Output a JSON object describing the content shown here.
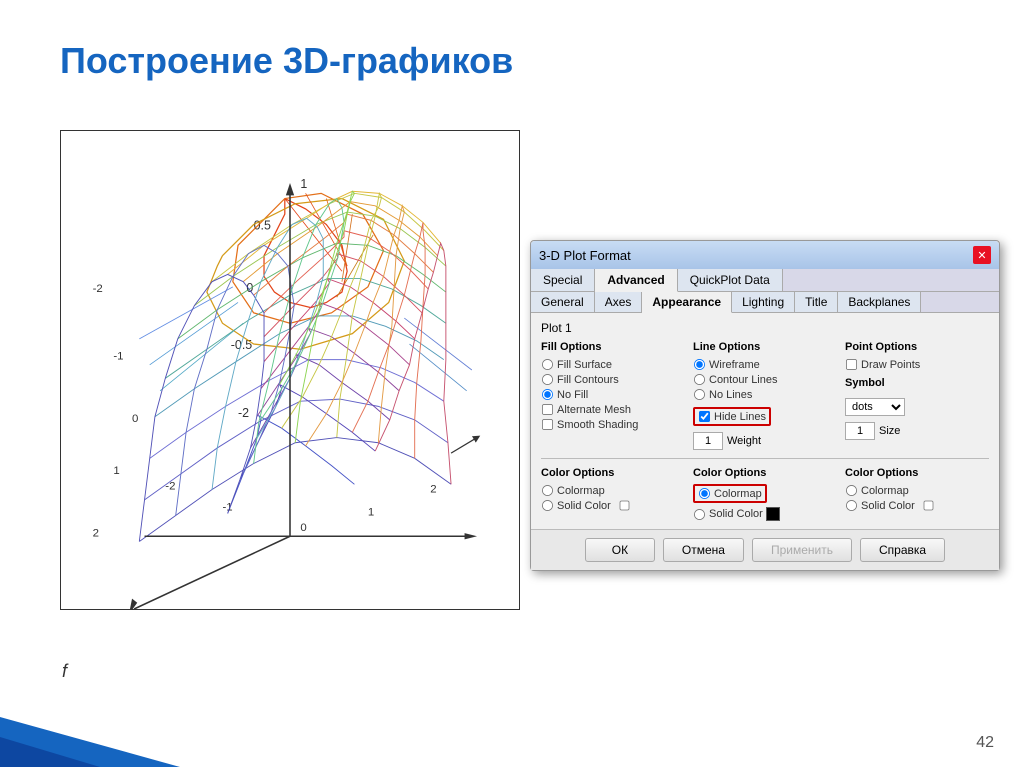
{
  "slide": {
    "title": "Построение 3D-графиков",
    "bottom_label": "f",
    "page_number": "42"
  },
  "dialog": {
    "title": "3-D Plot Format",
    "tabs_row1": [
      "Special",
      "Advanced",
      "QuickPlot Data"
    ],
    "tabs_row2": [
      "General",
      "Axes",
      "Appearance",
      "Lighting",
      "Title",
      "Backplanes"
    ],
    "active_tab_row1": "Advanced",
    "active_tab_row2": "Appearance",
    "plot_label": "Plot 1",
    "fill_options": {
      "header": "Fill Options",
      "items": [
        "Fill Surface",
        "Fill Contours",
        "No Fill",
        "Alternate Mesh",
        "Smooth Shading"
      ]
    },
    "line_options": {
      "header": "Line Options",
      "items": [
        "Wireframe",
        "Contour Lines",
        "No Lines"
      ],
      "hide_lines_checkbox": "Hide Lines",
      "weight_label": "Weight",
      "weight_value": "1"
    },
    "point_options": {
      "header": "Point Options",
      "draw_points_checkbox": "Draw Points",
      "symbol_label": "Symbol",
      "symbol_value": "dots",
      "size_label": "Size",
      "size_value": "1"
    },
    "color_options_fill": {
      "header": "Color Options",
      "items": [
        "Colormap",
        "Solid Color"
      ]
    },
    "color_options_line": {
      "header": "Color Options",
      "items": [
        "Colormap",
        "Solid Color"
      ]
    },
    "color_options_point": {
      "header": "Color Options",
      "items": [
        "Colormap",
        "Solid Color"
      ]
    },
    "buttons": {
      "ok": "ОК",
      "cancel": "Отмена",
      "apply": "Применить",
      "help": "Справка"
    }
  }
}
